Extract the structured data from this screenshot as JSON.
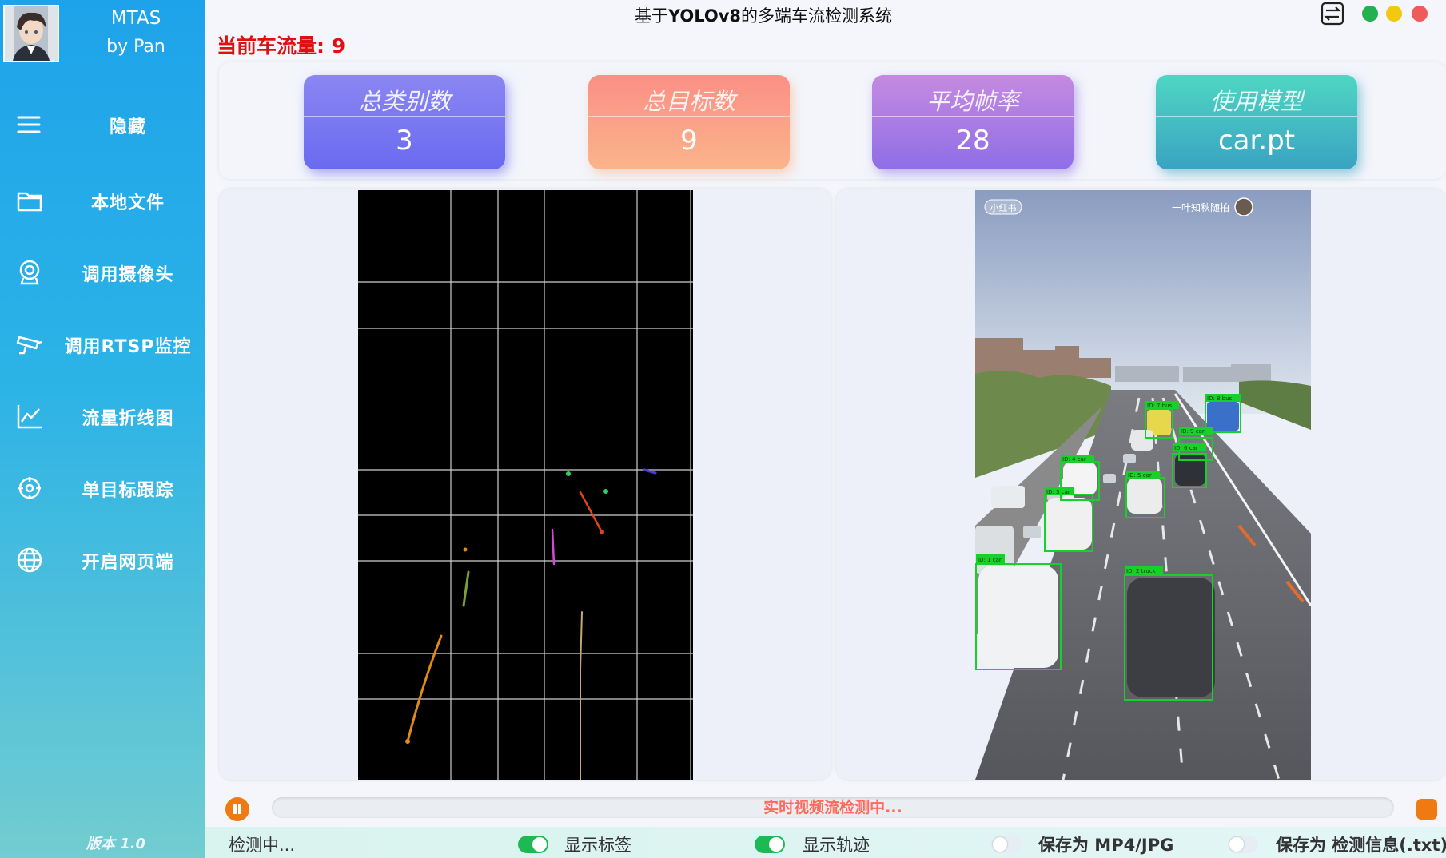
{
  "sidebar": {
    "app_name": "MTAS",
    "app_sub": "by Pan",
    "items": [
      {
        "label": "隐藏",
        "icon": "menu-icon"
      },
      {
        "label": "本地文件",
        "icon": "folder-icon"
      },
      {
        "label": "调用摄像头",
        "icon": "webcam-icon"
      },
      {
        "label": "调用RTSP监控",
        "icon": "cctv-icon"
      },
      {
        "label": "流量折线图",
        "icon": "line-chart-icon"
      },
      {
        "label": "单目标跟踪",
        "icon": "target-icon"
      },
      {
        "label": "开启网页端",
        "icon": "globe-icon"
      }
    ],
    "version": "版本 1.0"
  },
  "header": {
    "title_pre": "基于",
    "title_bold": "YOLOv8",
    "title_post": "的多端车流检测系统",
    "flow_label": "当前车流量: 9"
  },
  "window_controls": {
    "colors": {
      "maximize": "#22b14c",
      "minimize": "#f2c811",
      "close": "#ef5a5a"
    }
  },
  "stats": [
    {
      "title": "总类别数",
      "value": "3",
      "gradient": [
        "#8b86f2",
        "#6a6af0"
      ]
    },
    {
      "title": "总目标数",
      "value": "9",
      "gradient": [
        "#fb8f86",
        "#fbb48a"
      ]
    },
    {
      "title": "平均帧率",
      "value": "28",
      "gradient": [
        "#c58ae0",
        "#8f6ee8"
      ]
    },
    {
      "title": "使用模型",
      "value": "car.pt",
      "gradient": [
        "#4fd6c2",
        "#3aa3c2"
      ]
    }
  ],
  "video": {
    "watermark_left": "小红书",
    "watermark_right": "一叶知秋随拍",
    "boxes": [
      {
        "label": "ID: 1 car"
      },
      {
        "label": "ID: 2 truck"
      },
      {
        "label": "ID: 3 car"
      },
      {
        "label": "ID: 4 car"
      },
      {
        "label": "ID: 5 car"
      },
      {
        "label": "ID: 6 car"
      },
      {
        "label": "ID: 7 bus"
      },
      {
        "label": "ID: 8 bus"
      },
      {
        "label": "ID: 9 car"
      }
    ]
  },
  "progress": {
    "text": "实时视频流检测中...",
    "color": "#ff6a5c"
  },
  "status": {
    "text": "检测中...",
    "toggles": [
      {
        "label": "显示标签",
        "on": true
      },
      {
        "label": "显示轨迹",
        "on": true
      },
      {
        "label": "保存为 MP4/JPG",
        "on": false
      },
      {
        "label": "保存为 检测信息(.txt)",
        "on": false
      }
    ]
  }
}
